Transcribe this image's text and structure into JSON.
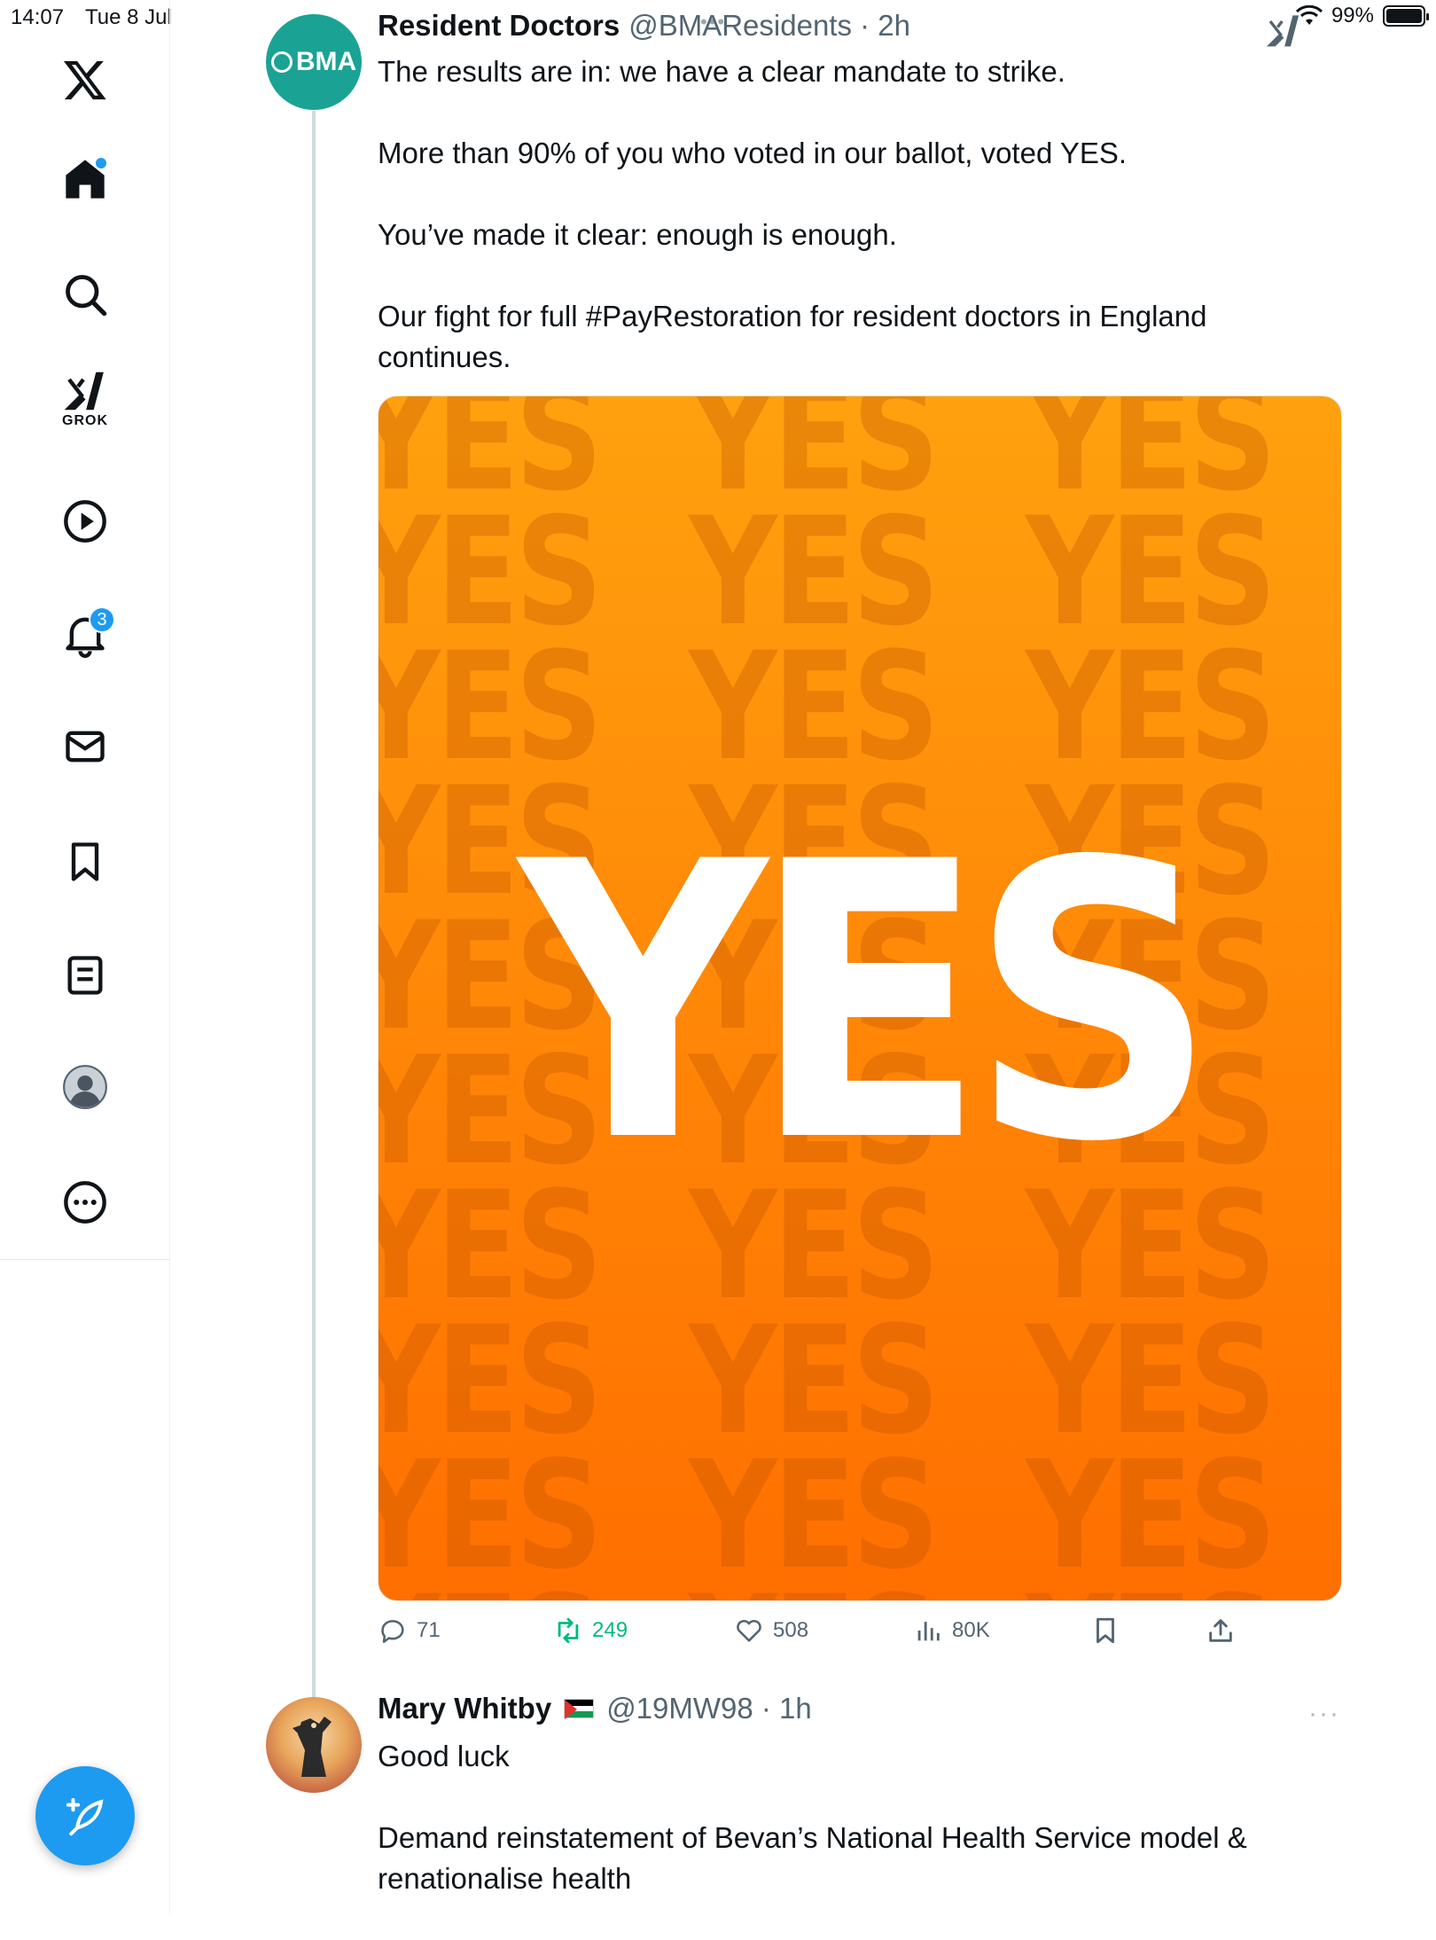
{
  "status_bar": {
    "time": "14:07",
    "date": "Tue 8 Jul",
    "dots": "•••",
    "battery": "99%"
  },
  "sidebar": {
    "items": [
      {
        "icon": "x-logo-icon"
      },
      {
        "icon": "home-icon"
      },
      {
        "icon": "search-icon"
      },
      {
        "icon": "grok-icon",
        "label": "GROK"
      },
      {
        "icon": "video-play-icon"
      },
      {
        "icon": "bell-icon",
        "badge": "3"
      },
      {
        "icon": "mail-icon"
      },
      {
        "icon": "bookmark-icon"
      },
      {
        "icon": "lists-icon"
      },
      {
        "icon": "profile-avatar-icon"
      },
      {
        "icon": "more-icon"
      }
    ],
    "compose_icon": "compose-feather-icon"
  },
  "tweet": {
    "avatar_text": "BMA",
    "author_name": "Resident Doctors",
    "handle_time": "@BMAResidents · 2h",
    "paragraphs": [
      "The results are in: we have a clear mandate to strike.",
      "More than 90% of you who voted in our ballot, voted YES.",
      "You’ve made it clear: enough is enough.",
      "Our fight for full #PayRestoration for resident doctors in England continues."
    ],
    "media": {
      "big_text": "YES",
      "pattern_text": "YES"
    },
    "actions": {
      "replies": "71",
      "reposts": "249",
      "likes": "508",
      "views": "80K"
    },
    "accent_color": "#1d9bf0",
    "repost_color": "#00ba7c"
  },
  "reply": {
    "author_name": "Mary Whitby",
    "handle_time": "@19MW98 · 1h",
    "more": "···",
    "paragraphs": [
      "Good luck",
      "Demand reinstatement of Bevan’s National Health Service model  & renationalise health"
    ]
  }
}
